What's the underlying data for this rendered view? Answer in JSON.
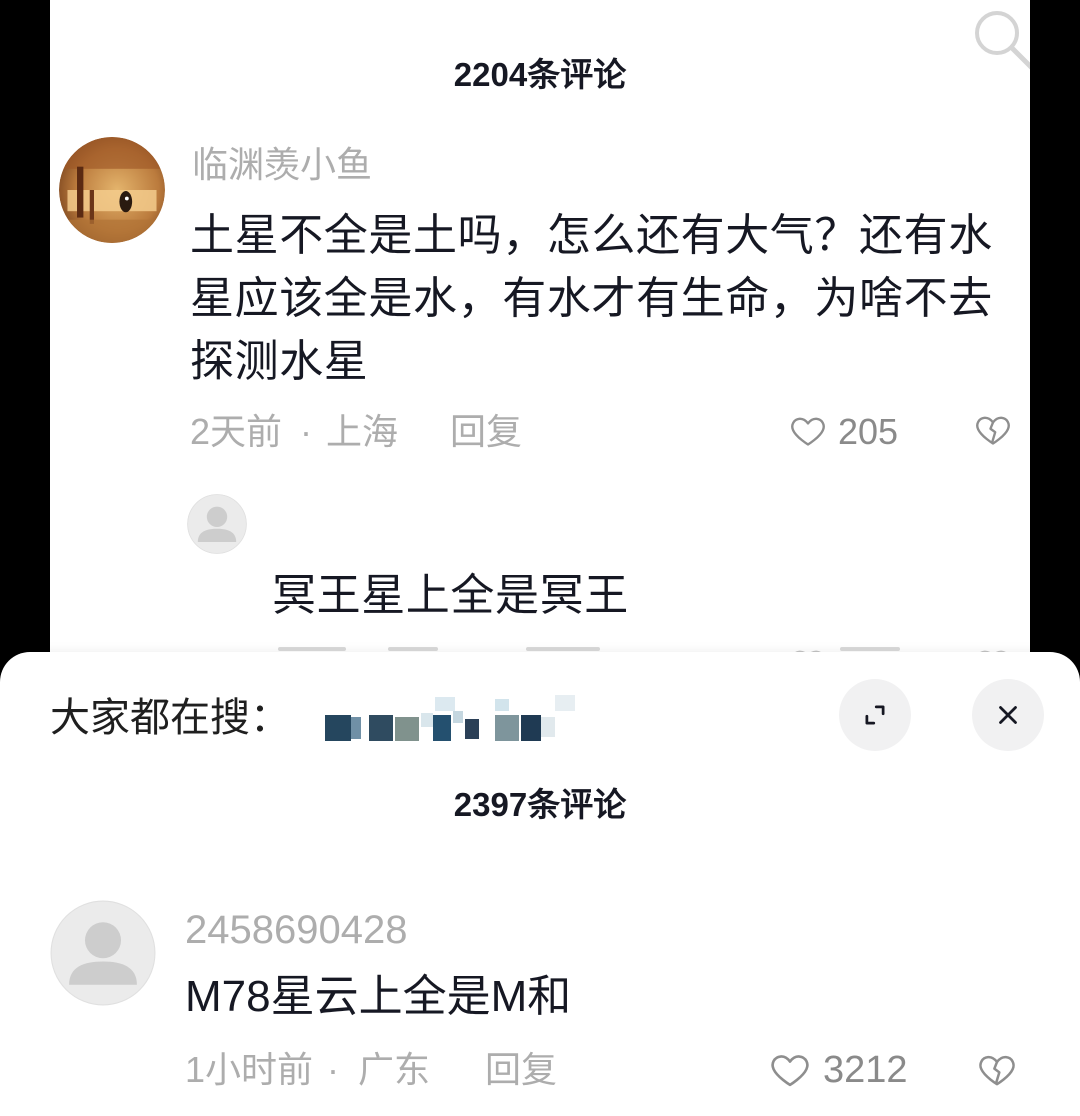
{
  "colors": {
    "background": "#000000",
    "panel": "#ffffff",
    "text_primary": "#161823",
    "text_secondary": "#adadad",
    "count": "#8a8a8a",
    "button": "#f1f1f2",
    "icon": "#8e8e8e"
  },
  "top_panel": {
    "search_icon": "search-icon",
    "title": "2204条评论",
    "comment": {
      "avatar_icon": "user-photo-avatar",
      "username": "临渊羡小鱼",
      "text_lines": [
        "土星不全是土吗，怎么还有大气？还有水",
        "星应该全是水，有水才有生命，为啥不去",
        "探测水星"
      ],
      "time": "2天前",
      "separator": "·",
      "location": "上海",
      "reply_label": "回复",
      "like_icon": "heart-outline-icon",
      "like_count": "205",
      "dislike_icon": "broken-heart-icon"
    },
    "reply": {
      "avatar_icon": "default-avatar-icon",
      "text": "冥王星上全是冥王"
    }
  },
  "comment_sheet": {
    "search_label": "大家都在搜：",
    "expand_icon": "expand-icon",
    "close_icon": "close-icon",
    "title": "2397条评论",
    "comment": {
      "avatar_icon": "default-avatar-icon",
      "username": "2458690428",
      "text": "M78星云上全是M和",
      "time": "1小时前",
      "separator": "·",
      "location": "广东",
      "reply_label": "回复",
      "like_icon": "heart-outline-icon",
      "like_count": "3212",
      "dislike_icon": "broken-heart-icon"
    }
  }
}
